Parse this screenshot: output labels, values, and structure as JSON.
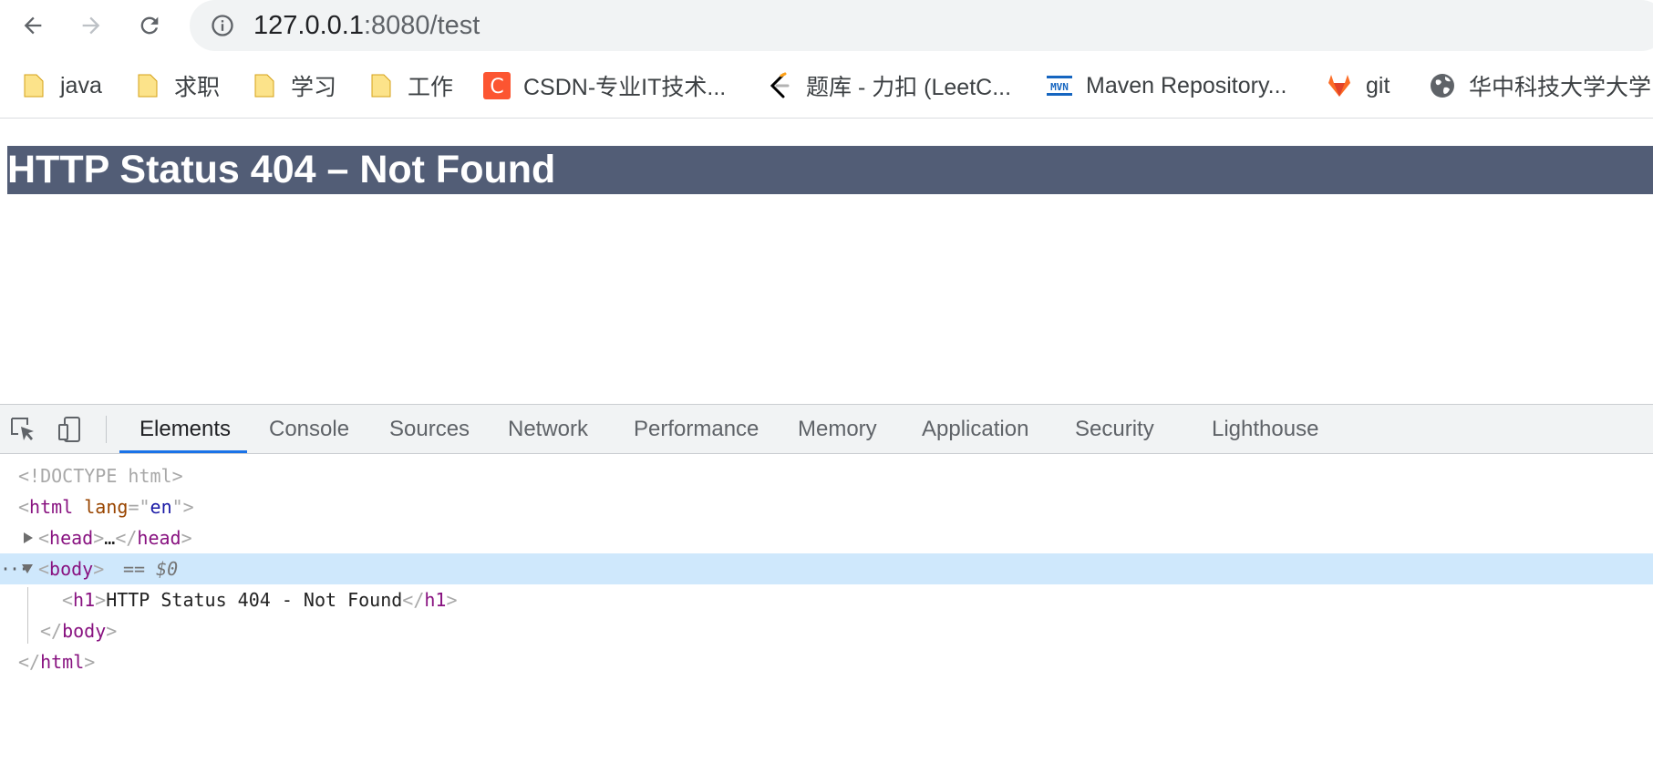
{
  "toolbar": {
    "back_icon": "arrow-left-icon",
    "forward_icon": "arrow-right-icon",
    "reload_icon": "reload-icon",
    "url_host": "127.0.0.1",
    "url_rest": ":8080/test",
    "info_icon": "info-icon"
  },
  "bookmarks": [
    {
      "label": "java",
      "icon": "folder-icon"
    },
    {
      "label": "求职",
      "icon": "folder-icon"
    },
    {
      "label": "学习",
      "icon": "folder-icon"
    },
    {
      "label": "工作",
      "icon": "folder-icon"
    },
    {
      "label": "CSDN-专业IT技术...",
      "icon": "csdn-icon"
    },
    {
      "label": "题库 - 力扣 (LeetC...",
      "icon": "leetcode-icon"
    },
    {
      "label": "Maven Repository...",
      "icon": "maven-icon"
    },
    {
      "label": "git",
      "icon": "gitlab-icon"
    },
    {
      "label": "华中科技大学大学...",
      "icon": "globe-icon"
    }
  ],
  "page": {
    "heading": "HTTP Status 404 – Not Found",
    "heading_bg": "#525d76"
  },
  "devtools": {
    "tabs": [
      {
        "label": "Elements",
        "active": true
      },
      {
        "label": "Console"
      },
      {
        "label": "Sources"
      },
      {
        "label": "Network"
      },
      {
        "label": "Performance"
      },
      {
        "label": "Memory"
      },
      {
        "label": "Application"
      },
      {
        "label": "Security"
      },
      {
        "label": "Lighthouse"
      }
    ],
    "dom": {
      "doctype": "<!DOCTYPE html>",
      "html_open": "html",
      "lang_attr": "lang",
      "lang_value": "en",
      "head": "head",
      "ellipsis": "…",
      "body": "body",
      "selected_ref": "== $0",
      "h1": "h1",
      "h1_text": "HTTP Status 404 - Not Found",
      "body_close": "body",
      "html_close": "html"
    },
    "accent": "#1a73e8",
    "selection_bg": "#cfe8fc"
  }
}
